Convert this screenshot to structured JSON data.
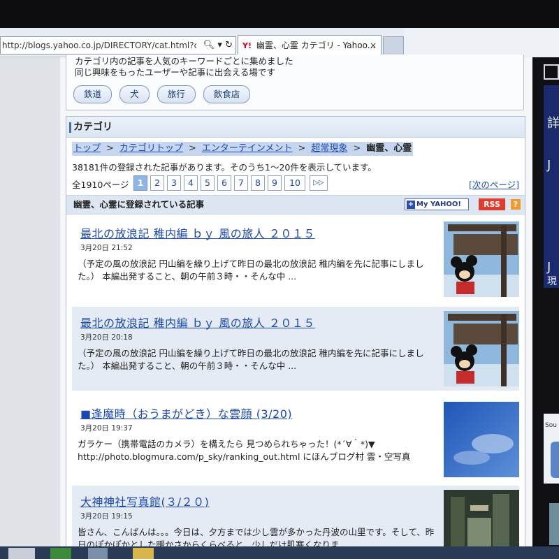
{
  "browser": {
    "url": "http://blogs.yahoo.co.jp/DIRECTORY/cat.html?ci",
    "tab_title": "幽霊、心霊 カテゴリ - Yahoo...",
    "tab_icon_text": "Y!",
    "tab_close": "×"
  },
  "intro": {
    "line1": "カテゴリ内の記事を人気のキーワードごとに集めました",
    "line2": "同じ興味をもったユーザーや記事に出会える場です",
    "tags": [
      "鉄道",
      "犬",
      "旅行",
      "飲食店"
    ]
  },
  "category": {
    "heading": "カテゴリ",
    "breadcrumb": [
      "トップ",
      "カテゴリトップ",
      "エンターテインメント",
      "超常現象"
    ],
    "breadcrumb_sep": ">",
    "current": "幽霊、心霊",
    "count_text": "38181件の登録された記事があります。そのうち1～20件を表示しています。"
  },
  "pager": {
    "total": "全1910ページ",
    "pages": [
      "1",
      "2",
      "3",
      "4",
      "5",
      "6",
      "7",
      "8",
      "9",
      "10"
    ],
    "current": "1",
    "next_arrow": "▷▷",
    "next_label": "[次のページ]"
  },
  "list": {
    "heading": "幽霊、心霊に登録されている記事",
    "myyahoo": "My YAHOO!",
    "myyahoo_plus": "+",
    "rss": "RSS",
    "help": "?"
  },
  "articles": [
    {
      "title": "最北の放浪記 稚内編 ｂｙ 風の旅人 ２０１５",
      "date": "3月20日 21:52",
      "body": "（予定の風の放浪記 円山編を繰り上げて昨日の最北の放浪記 稚内編を先に記事にしました。） 本編出発すること、朝の午前３時・・そんな中 ...",
      "thumb": "sign-photo"
    },
    {
      "title": "最北の放浪記 稚内編 ｂｙ 風の旅人 ２０１５",
      "date": "3月20日 20:18",
      "body": "（予定の風の放浪記 円山編を繰り上げて昨日の最北の放浪記 稚内編を先に記事にしました。） 本編出発すること、朝の午前３時・・そんな中 ...",
      "thumb": "sign-photo"
    },
    {
      "title": "■逢魔時（おうまがどき）な雲顔 (3/20)",
      "date": "3月20日 19:37",
      "body": "ガラケー（携帯電話のカメラ）を構えたら 見つめられちゃった！(*´∀｀*)▼ http://photo.blogmura.com/p_sky/ranking_out.html にほんブログ村 雲・空写真",
      "thumb": "sky-photo"
    },
    {
      "title": "大神神社写真館(３/２０)",
      "date": "3月20日 19:15",
      "body": "皆さん、こんばんは。。。今日は、夕方までは少し雲が多かった丹波の山里です。そして、昨日のぽかぽかとした暖かさからくらべると、少しだけ肌寒くなりま",
      "thumb": "shrine-photo"
    }
  ],
  "sidebar": {
    "partial_chars": [
      "詳",
      "J",
      "J",
      "現"
    ],
    "partial_label": "Sou"
  },
  "colors": {
    "link": "#1b49b0",
    "header_bg": "#dde7f4",
    "alt_row": "#e5ebf4",
    "rss": "#e23c2c"
  }
}
